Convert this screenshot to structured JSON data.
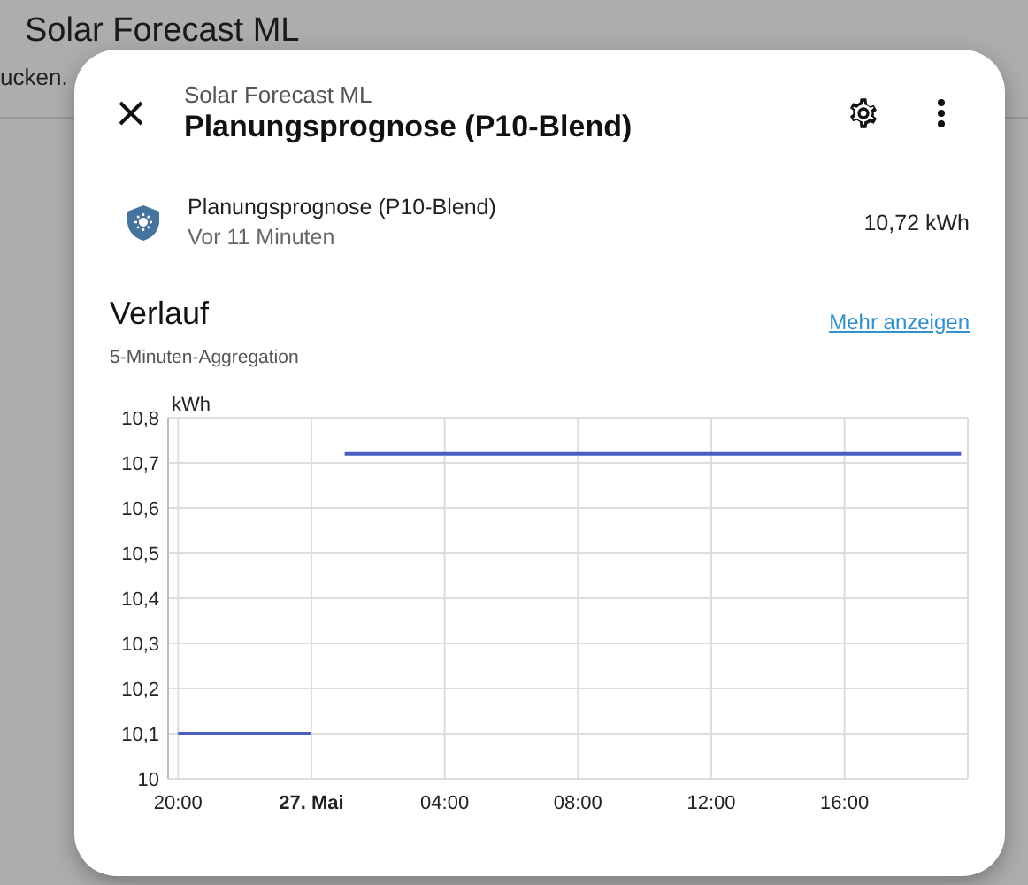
{
  "background": {
    "title": "Solar Forecast ML",
    "text_fragment": "ucken."
  },
  "dialog": {
    "subtitle": "Solar Forecast ML",
    "title": "Planungsprognose (P10-Blend)",
    "entity": {
      "name": "Planungsprognose (P10-Blend)",
      "time": "Vor 11 Minuten",
      "value": "10,72 kWh"
    },
    "history": {
      "title": "Verlauf",
      "subtitle": "5-Minuten-Aggregation",
      "link": "Mehr anzeigen",
      "chart_data": {
        "type": "line",
        "ylabel": "kWh",
        "grid": true,
        "categories": [
          "20:00",
          null,
          null,
          null,
          null,
          null,
          null,
          null,
          "27. Mai",
          null,
          null,
          null,
          null,
          null,
          null,
          null,
          "04:00",
          null,
          null,
          null,
          null,
          null,
          null,
          null,
          "08:00",
          null,
          null,
          null,
          null,
          null,
          null,
          null,
          "12:00",
          null,
          null,
          null,
          null,
          null,
          null,
          null,
          "16:00",
          null,
          null,
          null,
          null,
          null,
          null,
          null
        ],
        "series": [
          {
            "color": "#4a5fc1",
            "values": [
              10.1,
              10.1,
              10.1,
              10.1,
              10.1,
              10.1,
              10.1,
              10.1,
              10.1,
              null,
              10.72,
              10.72,
              10.72,
              10.72,
              10.72,
              10.72,
              10.72,
              10.72,
              10.72,
              10.72,
              10.72,
              10.72,
              10.72,
              10.72,
              10.72,
              10.72,
              10.72,
              10.72,
              10.72,
              10.72,
              10.72,
              10.72,
              10.72,
              10.72,
              10.72,
              10.72,
              10.72,
              10.72,
              10.72,
              10.72,
              10.72,
              10.72,
              10.72,
              10.72,
              10.72,
              10.72,
              10.72,
              10.72
            ]
          }
        ],
        "ylim": [
          10,
          10.8
        ],
        "yticks": [
          {
            "value": 10,
            "label": "10"
          },
          {
            "value": 10.1,
            "label": "10,1"
          },
          {
            "value": 10.2,
            "label": "10,2"
          },
          {
            "value": 10.3,
            "label": "10,3"
          },
          {
            "value": 10.4,
            "label": "10,4"
          },
          {
            "value": 10.5,
            "label": "10,5"
          },
          {
            "value": 10.6,
            "label": "10,6"
          },
          {
            "value": 10.7,
            "label": "10,7"
          },
          {
            "value": 10.8,
            "label": "10,8"
          }
        ]
      }
    }
  }
}
